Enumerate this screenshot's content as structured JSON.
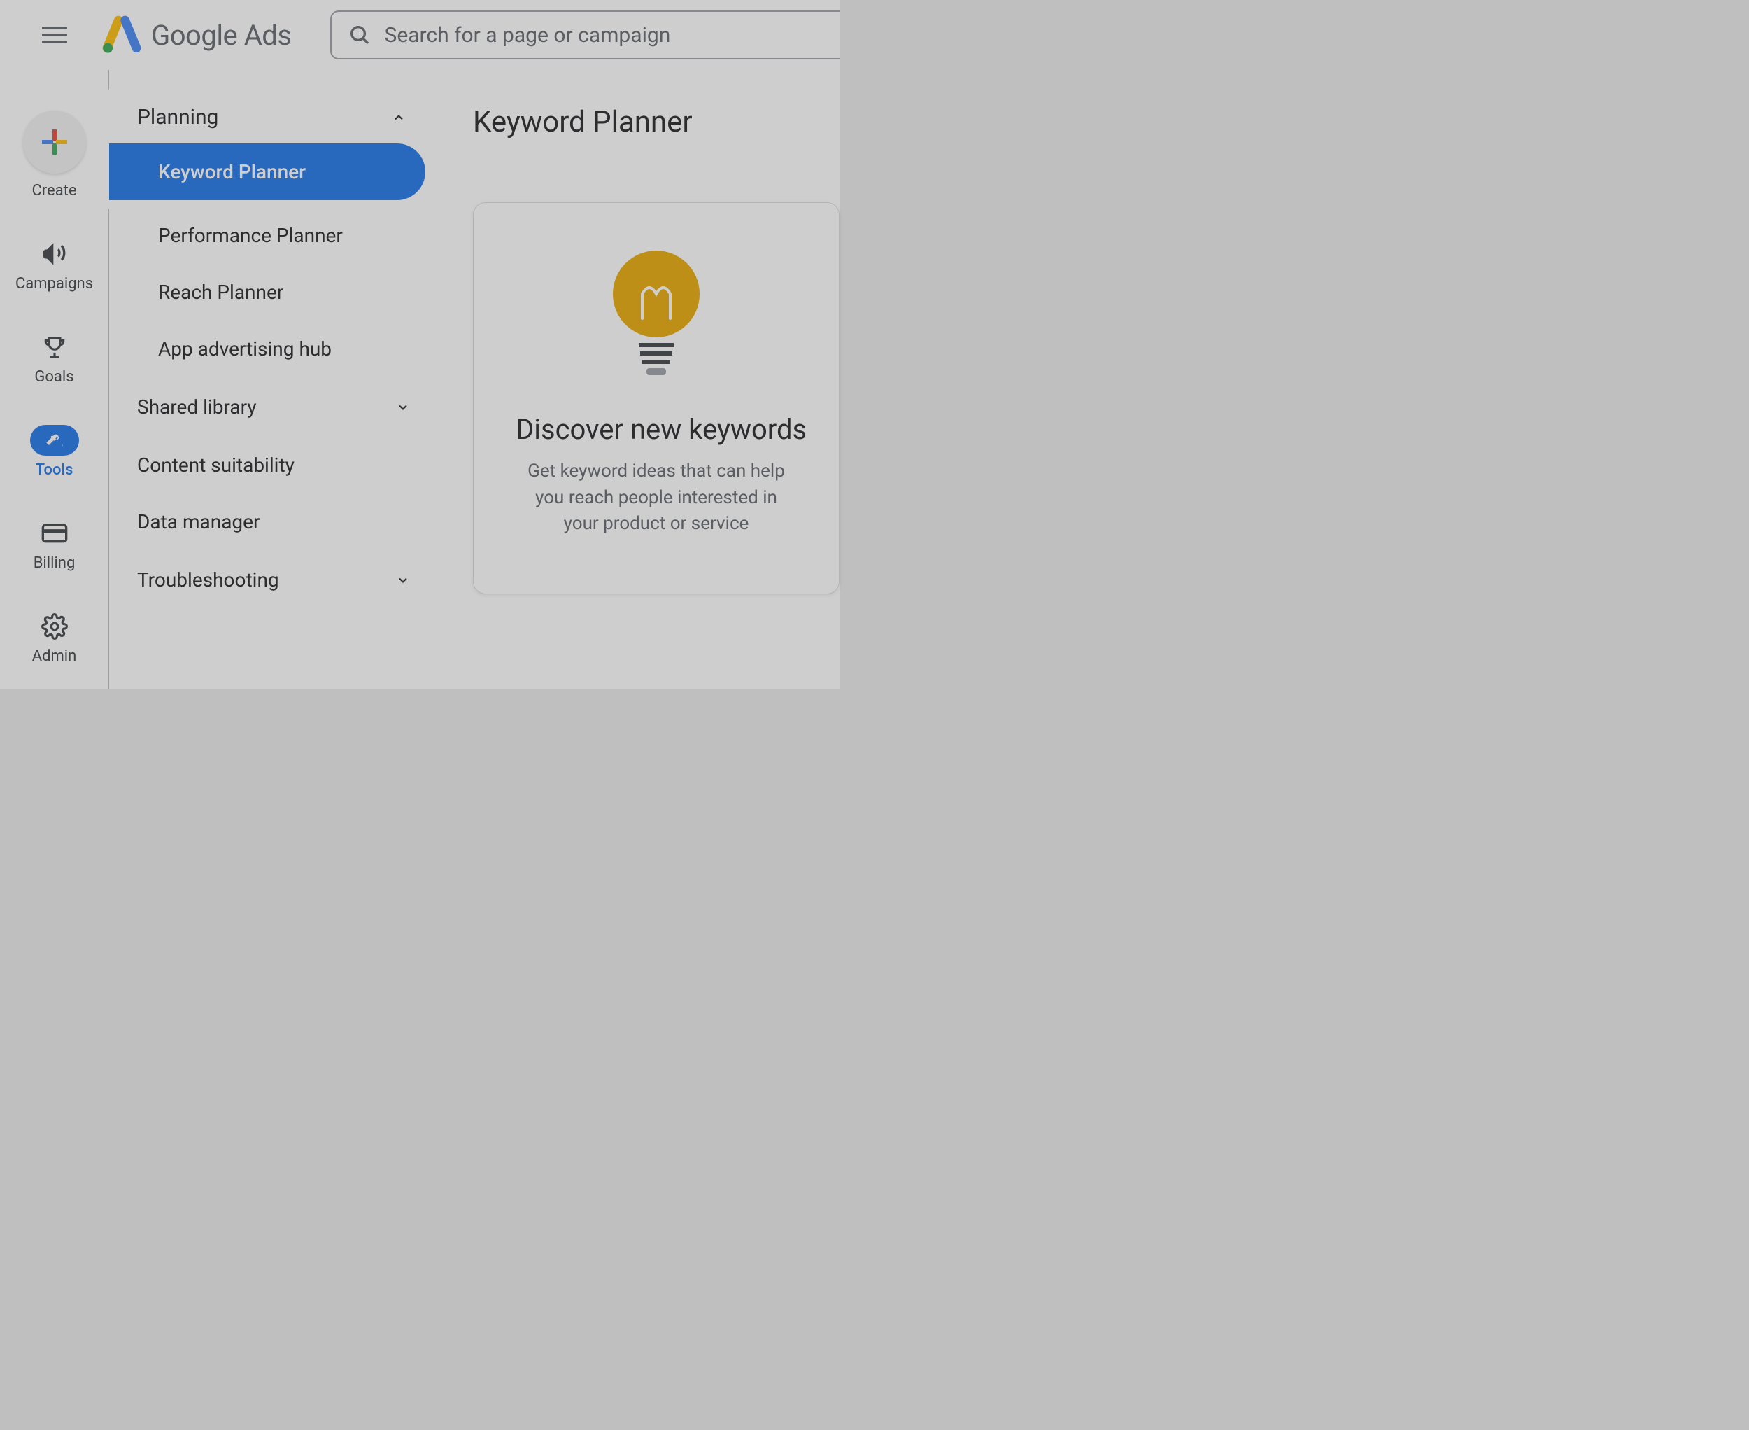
{
  "header": {
    "logo_text_1": "Google",
    "logo_text_2": " Ads",
    "search_placeholder": "Search for a page or campaign"
  },
  "rail": {
    "create": "Create",
    "campaigns": "Campaigns",
    "goals": "Goals",
    "tools": "Tools",
    "billing": "Billing",
    "admin": "Admin"
  },
  "nav": {
    "planning": "Planning",
    "keyword_planner": "Keyword Planner",
    "performance_planner": "Performance Planner",
    "reach_planner": "Reach Planner",
    "app_hub": "App advertising hub",
    "shared_library": "Shared library",
    "content_suitability": "Content suitability",
    "data_manager": "Data manager",
    "troubleshooting": "Troubleshooting"
  },
  "main": {
    "title": "Keyword Planner",
    "card_title": "Discover new keywords",
    "card_desc": "Get keyword ideas that can help you reach people interested in your product or service"
  }
}
